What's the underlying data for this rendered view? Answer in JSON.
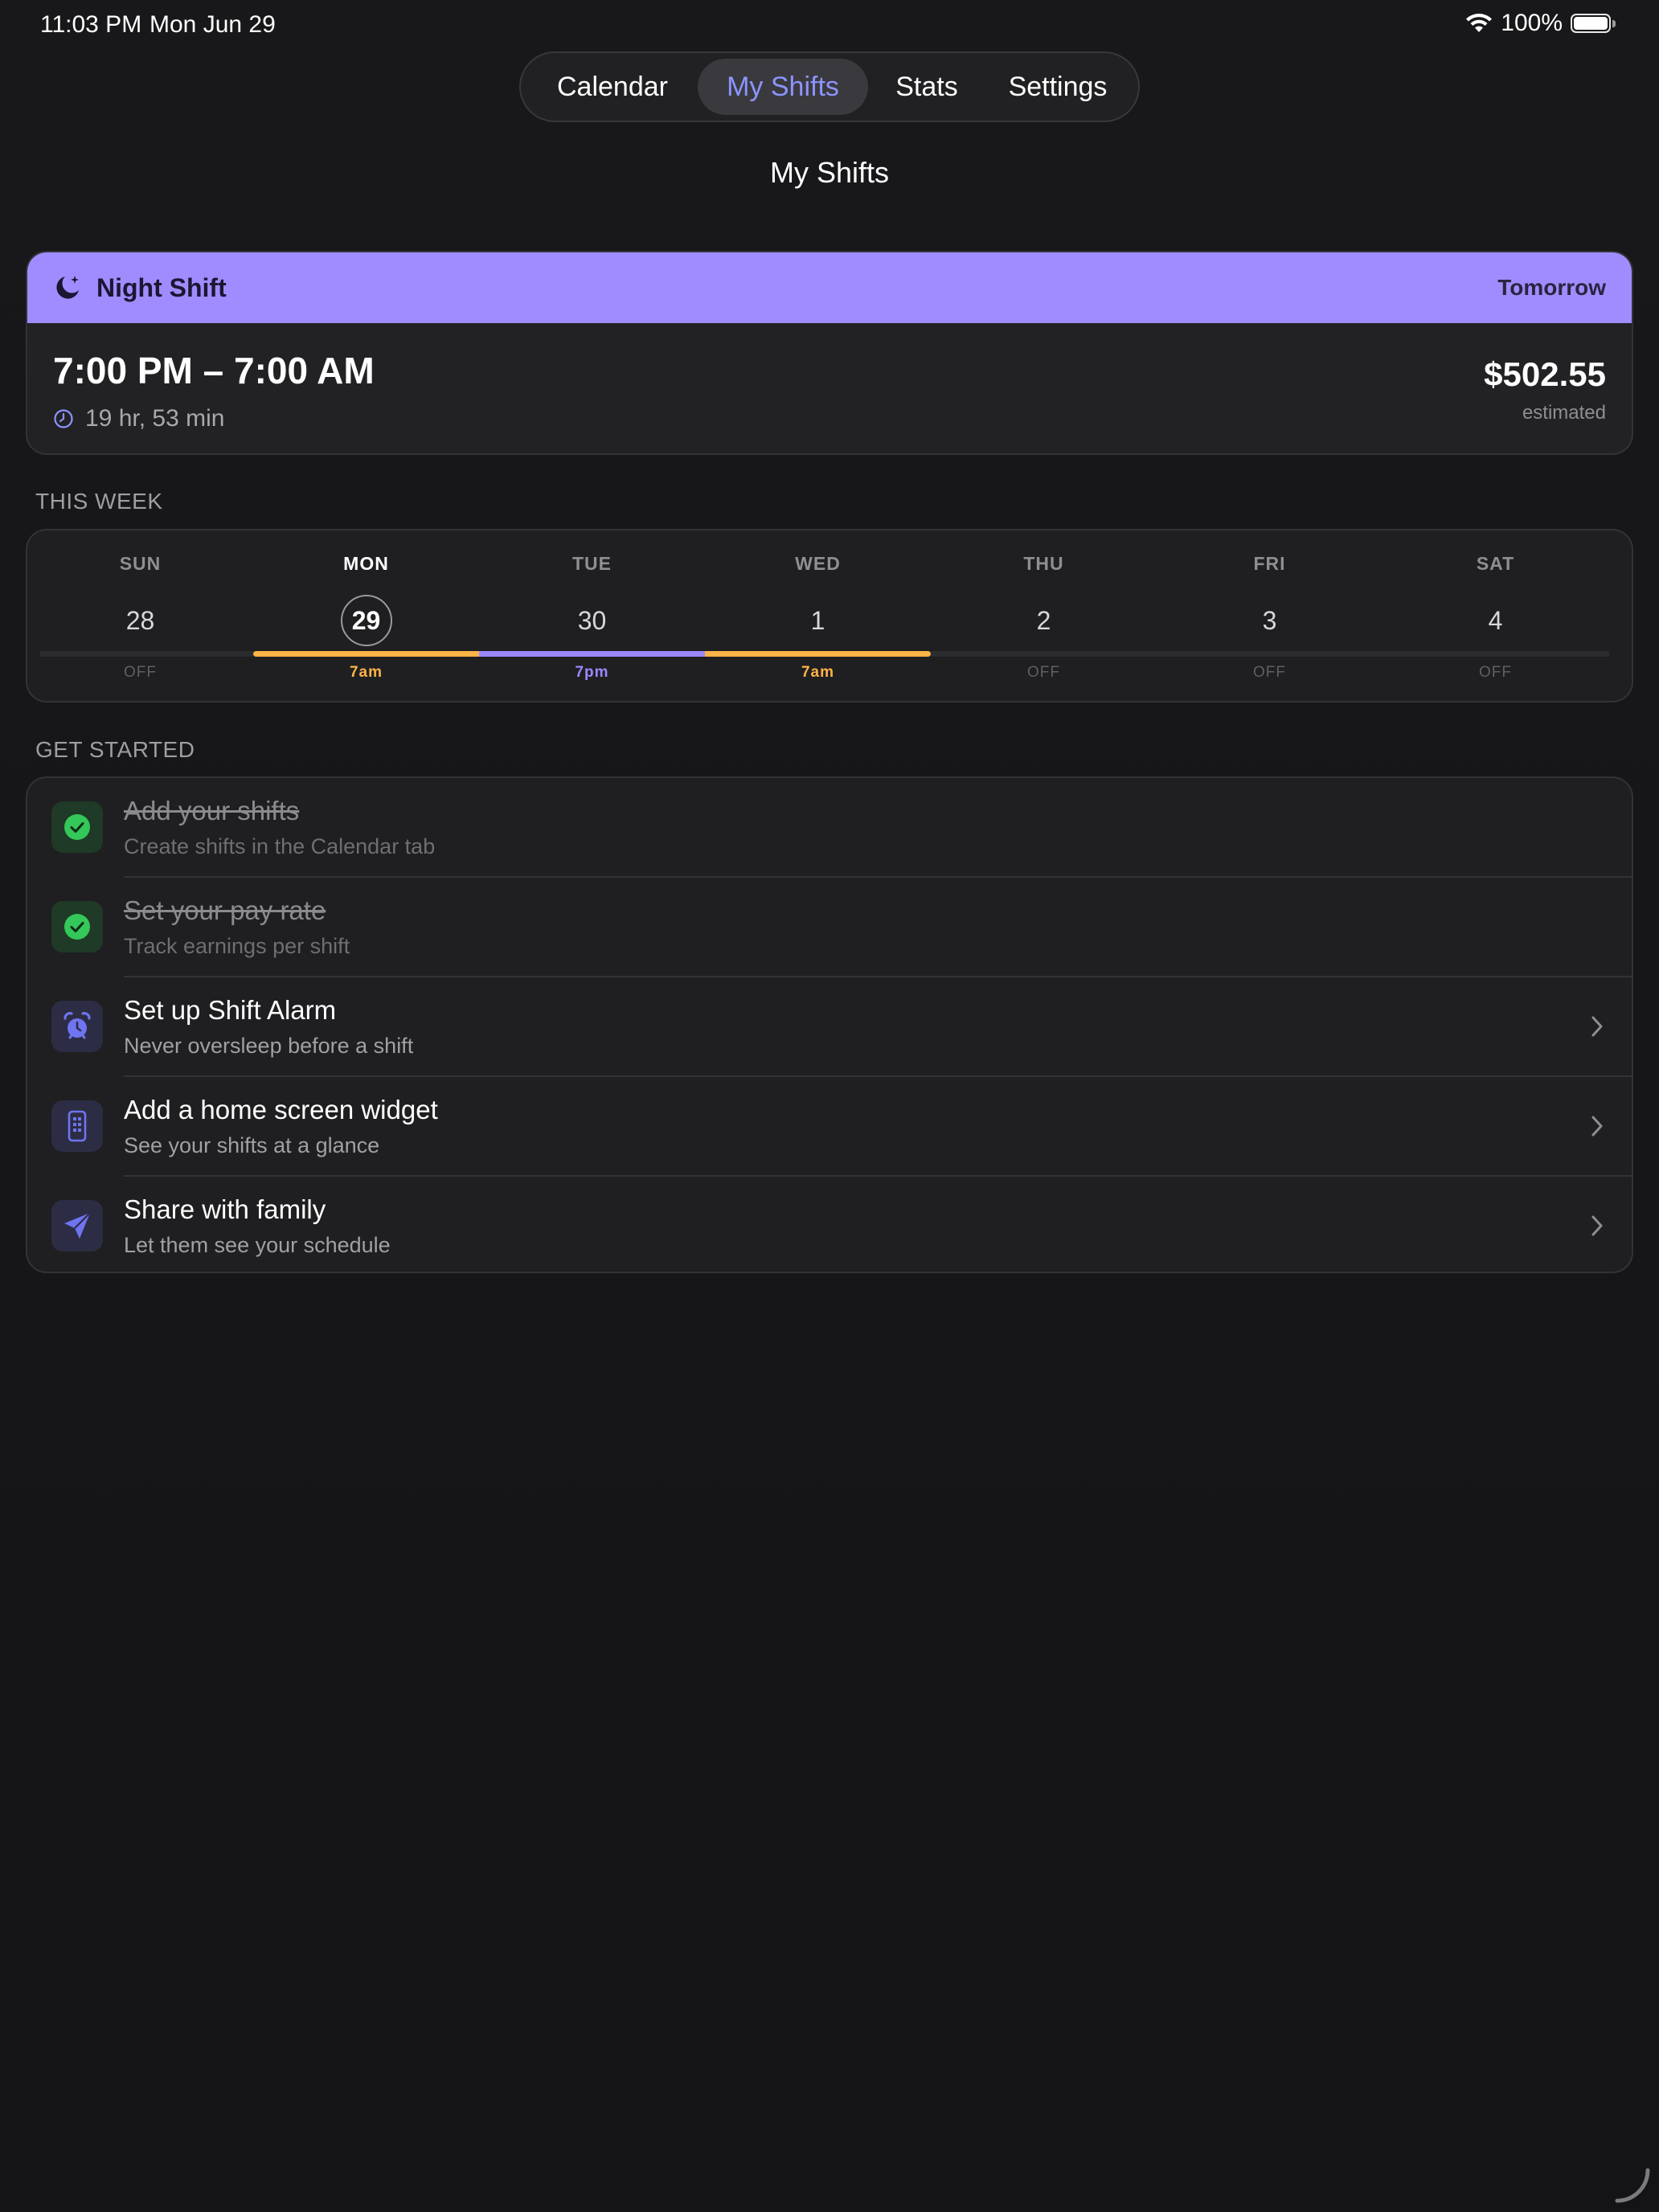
{
  "status_bar": {
    "time": "11:03 PM",
    "date": "Mon Jun 29",
    "battery_pct": "100%"
  },
  "tabs": [
    {
      "label": "Calendar",
      "selected": false
    },
    {
      "label": "My Shifts",
      "selected": true
    },
    {
      "label": "Stats",
      "selected": false
    },
    {
      "label": "Settings",
      "selected": false
    }
  ],
  "page_title": "My Shifts",
  "next_shift": {
    "name": "Night Shift",
    "when": "Tomorrow",
    "time_range": "7:00 PM – 7:00 AM",
    "countdown": "19 hr, 53 min",
    "pay": "$502.55",
    "pay_note": "estimated",
    "header_color": "#a08cff",
    "icon": "moon-stars-icon"
  },
  "this_week": {
    "label": "THIS WEEK",
    "days": [
      {
        "name": "SUN",
        "num": "28",
        "label": "OFF",
        "color": ""
      },
      {
        "name": "MON",
        "num": "29",
        "label": "7am",
        "color": "#ffb347",
        "today": true
      },
      {
        "name": "TUE",
        "num": "30",
        "label": "7pm",
        "color": "#9a88ff"
      },
      {
        "name": "WED",
        "num": "1",
        "label": "7am",
        "color": "#ffb347"
      },
      {
        "name": "THU",
        "num": "2",
        "label": "OFF",
        "color": ""
      },
      {
        "name": "FRI",
        "num": "3",
        "label": "OFF",
        "color": ""
      },
      {
        "name": "SAT",
        "num": "4",
        "label": "OFF",
        "color": ""
      }
    ]
  },
  "get_started": {
    "label": "GET STARTED",
    "items": [
      {
        "title": "Add your shifts",
        "subtitle": "Create shifts in the Calendar tab",
        "done": true,
        "icon": "checkmark-circle-icon"
      },
      {
        "title": "Set your pay rate",
        "subtitle": "Track earnings per shift",
        "done": true,
        "icon": "checkmark-circle-icon"
      },
      {
        "title": "Set up Shift Alarm",
        "subtitle": "Never oversleep before a shift",
        "done": false,
        "icon": "alarm-clock-icon"
      },
      {
        "title": "Add a home screen widget",
        "subtitle": "See your shifts at a glance",
        "done": false,
        "icon": "phone-widget-icon"
      },
      {
        "title": "Share with family",
        "subtitle": "Let them see your schedule",
        "done": false,
        "icon": "paper-plane-icon"
      }
    ]
  },
  "colors": {
    "accent": "#8c94ff",
    "morning": "#ffb347",
    "night": "#9a88ff",
    "done_green": "#34c759"
  }
}
